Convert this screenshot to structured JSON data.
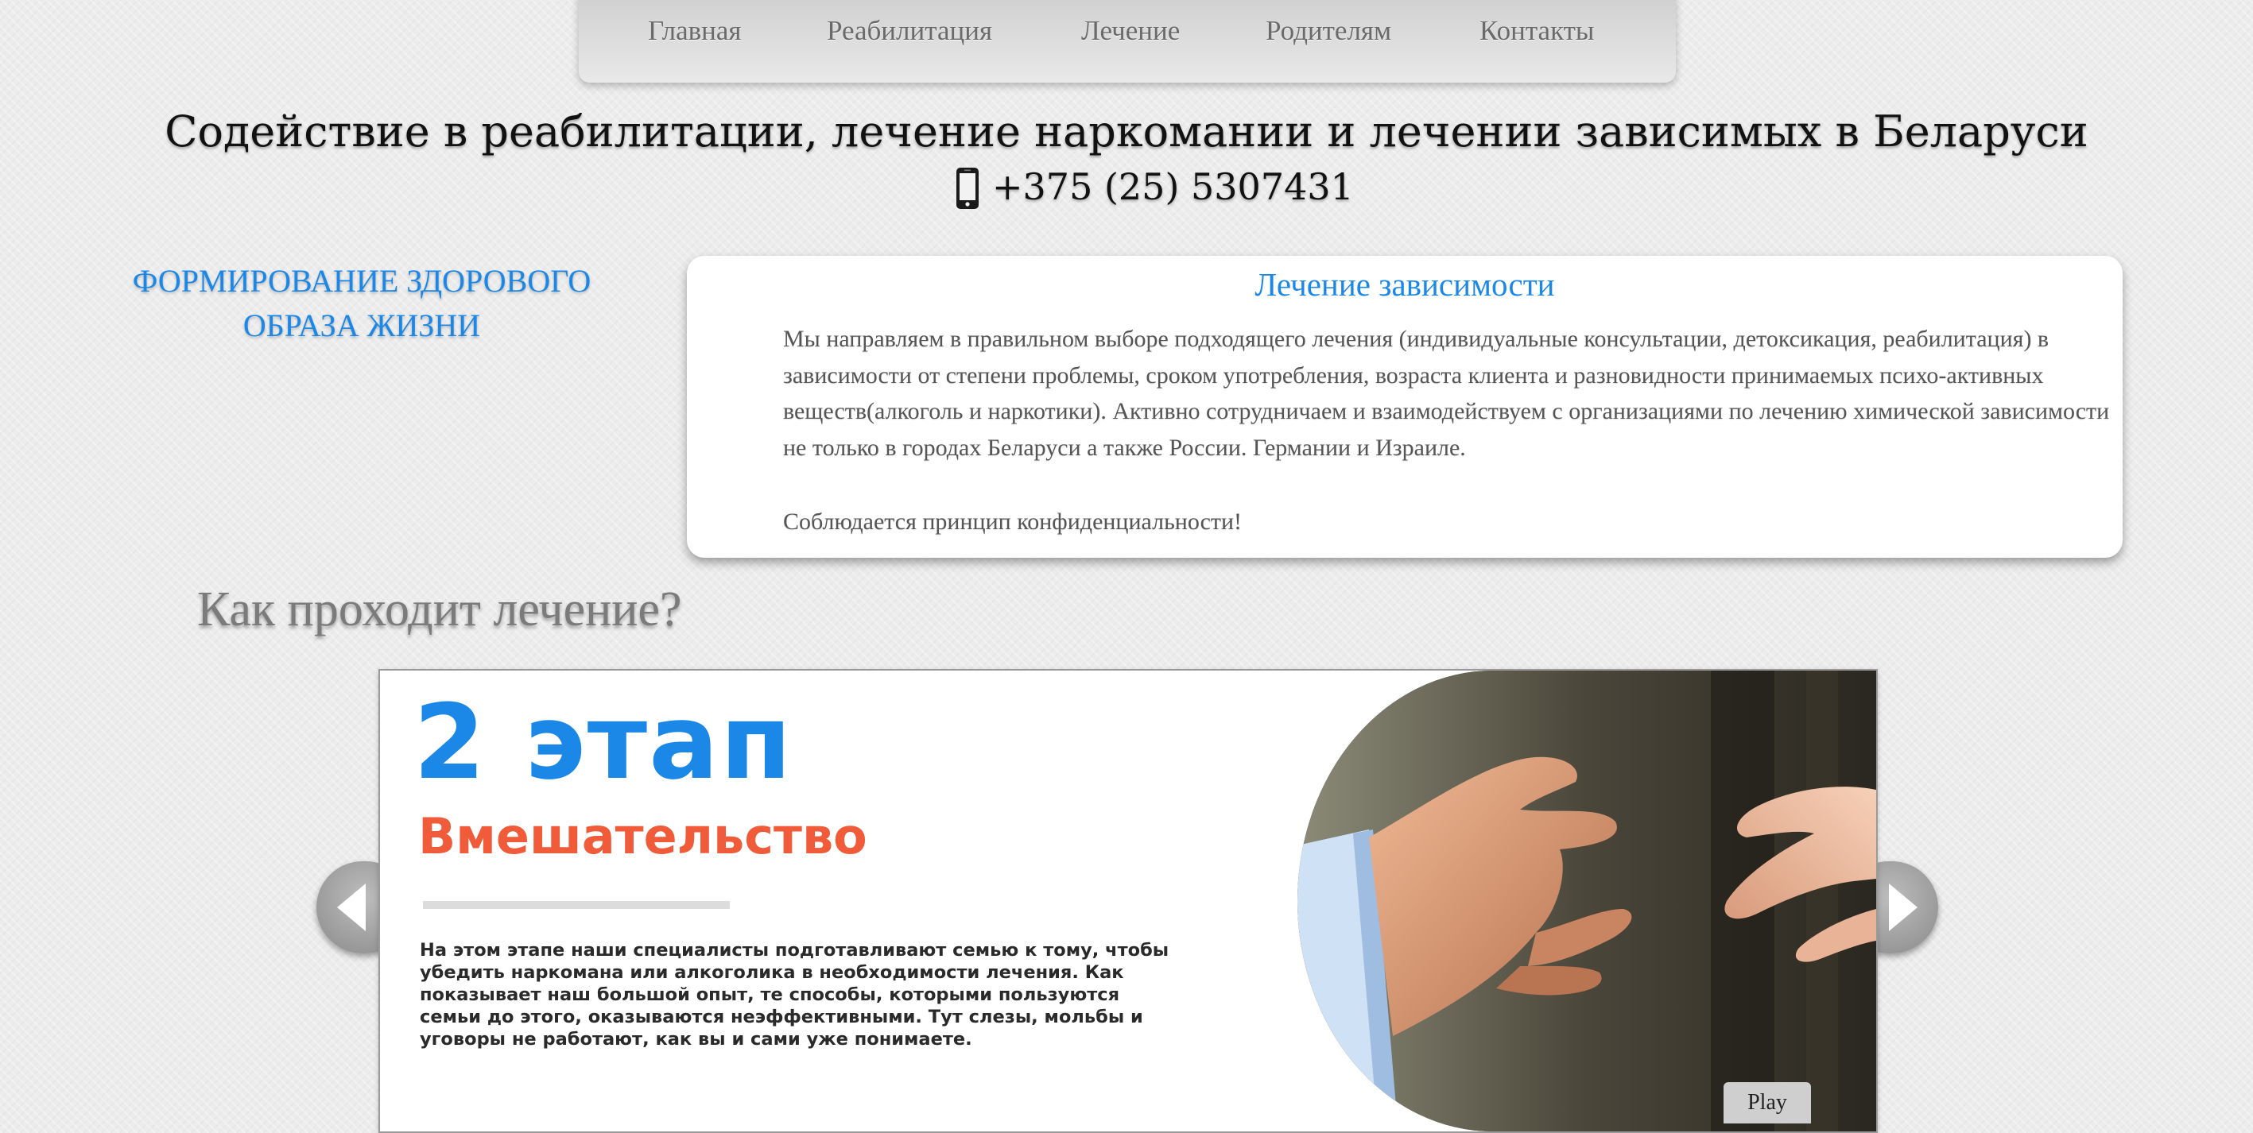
{
  "nav": {
    "items": [
      {
        "label": "Главная"
      },
      {
        "label": "Реабилитация"
      },
      {
        "label": "Лечение"
      },
      {
        "label": "Родителям"
      },
      {
        "label": "Контакты"
      }
    ]
  },
  "header": {
    "title": "Содействие в реабилитации, лечение наркомании и лечении зависимых в Беларуси",
    "phone": "+375 (25) 5307431"
  },
  "sidebar": {
    "heading": "ФОРМИРОВАНИЕ ЗДОРОВОГО ОБРАЗА ЖИЗНИ"
  },
  "card": {
    "title": "Лечение зависимости",
    "text": "Мы направляем в правильном выборе подходящего лечения (индивидуальные консультации, детоксикация, реабилитация) в зависимости от степени проблемы, сроком употребления, возраста клиента и разновидности принимаемых психо-активных веществ(алкоголь и наркотики). Активно сотрудничаем и взаимодействуем с организациями по лечению химической зависимости не только в городах Беларуси а также России. Германии и Израиле.",
    "note": "Соблюдается принцип конфиденциальности!"
  },
  "section": {
    "heading": "Как проходит лечение?"
  },
  "slider": {
    "stage_number": "2 этап",
    "stage_name": "Вмешательство",
    "stage_text": "На этом этапе наши специалисты подготавливают семью к тому, чтобы убедить наркомана или алкоголика в необходимости лечения. Как показывает наш большой опыт, те способы, которыми пользуются семьи до этого, оказываются неэффективными. Тут слезы, мольбы и уговоры не работают, как вы и сами уже понимаете.",
    "play_label": "Play",
    "prev_icon": "arrow-left-icon",
    "next_icon": "arrow-right-icon"
  },
  "colors": {
    "accent": "#1b88e8",
    "stage_name": "#f05b3a",
    "nav_text": "#6a6a6a"
  }
}
